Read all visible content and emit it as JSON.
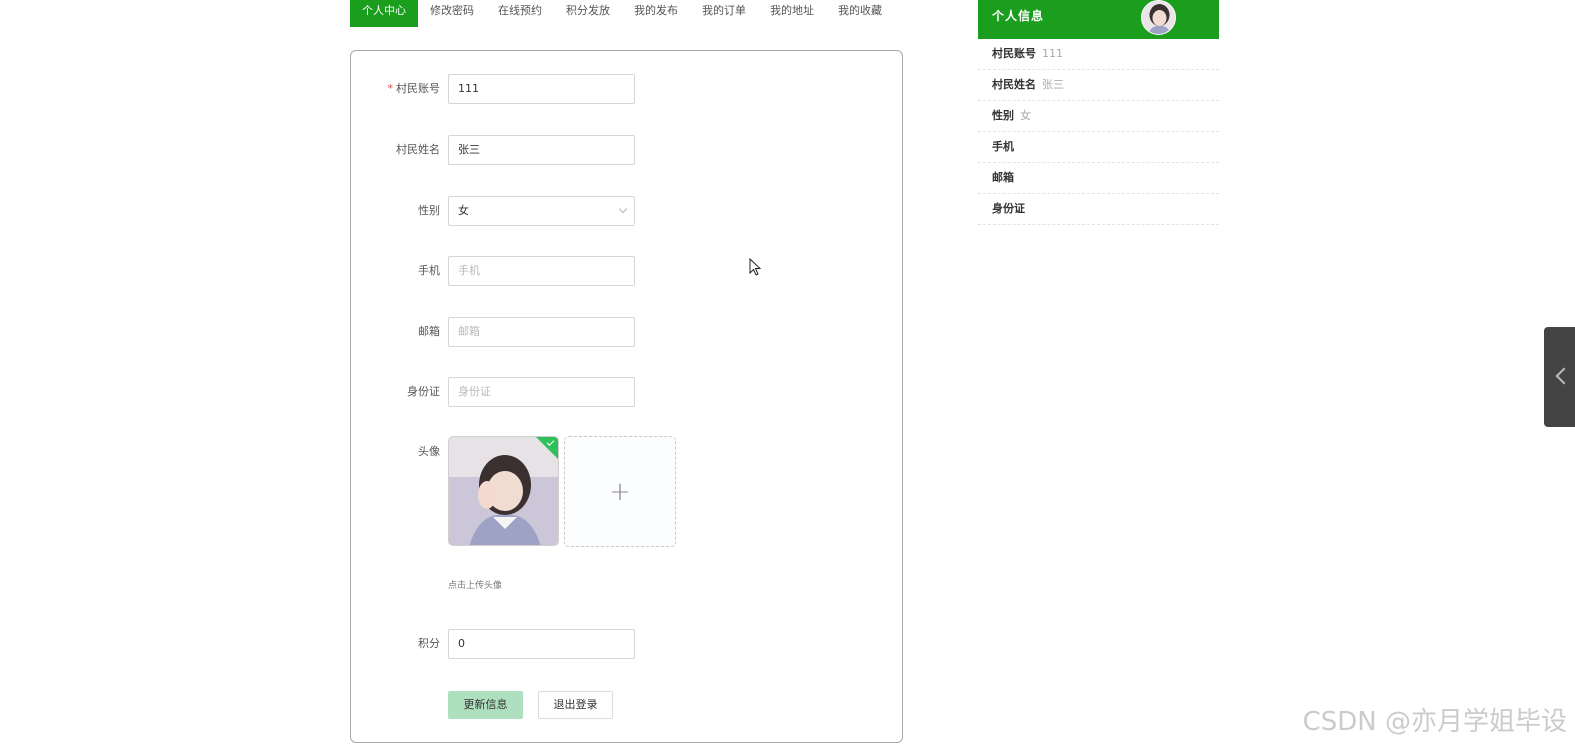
{
  "tabs": [
    {
      "label": "个人中心",
      "active": true
    },
    {
      "label": "修改密码"
    },
    {
      "label": "在线预约"
    },
    {
      "label": "积分发放"
    },
    {
      "label": "我的发布"
    },
    {
      "label": "我的订单"
    },
    {
      "label": "我的地址"
    },
    {
      "label": "我的收藏"
    }
  ],
  "form": {
    "account": {
      "label": "村民账号",
      "required_mark": "*",
      "value": "111"
    },
    "name": {
      "label": "村民姓名",
      "value": "张三"
    },
    "gender": {
      "label": "性别",
      "value": "女"
    },
    "phone": {
      "label": "手机",
      "placeholder": "手机"
    },
    "email": {
      "label": "邮箱",
      "placeholder": "邮箱"
    },
    "idcard": {
      "label": "身份证",
      "placeholder": "身份证"
    },
    "avatar": {
      "label": "头像",
      "upload_icon": "plus-icon",
      "hint": "点击上传头像"
    },
    "points": {
      "label": "积分",
      "value": "0"
    },
    "update_button": "更新信息",
    "logout_button": "退出登录"
  },
  "info": {
    "title": "个人信息",
    "rows": [
      {
        "key": "村民账号",
        "value": "111"
      },
      {
        "key": "村民姓名",
        "value": "张三"
      },
      {
        "key": "性别",
        "value": "女"
      },
      {
        "key": "手机",
        "value": ""
      },
      {
        "key": "邮箱",
        "value": ""
      },
      {
        "key": "身份证",
        "value": ""
      }
    ]
  },
  "side_tab_icon": "chevron-left-icon",
  "watermark": "CSDN @亦月学姐毕设",
  "colors": {
    "primary": "#1b9e1e",
    "update_button": "#aee0bf",
    "required": "#e04646"
  }
}
